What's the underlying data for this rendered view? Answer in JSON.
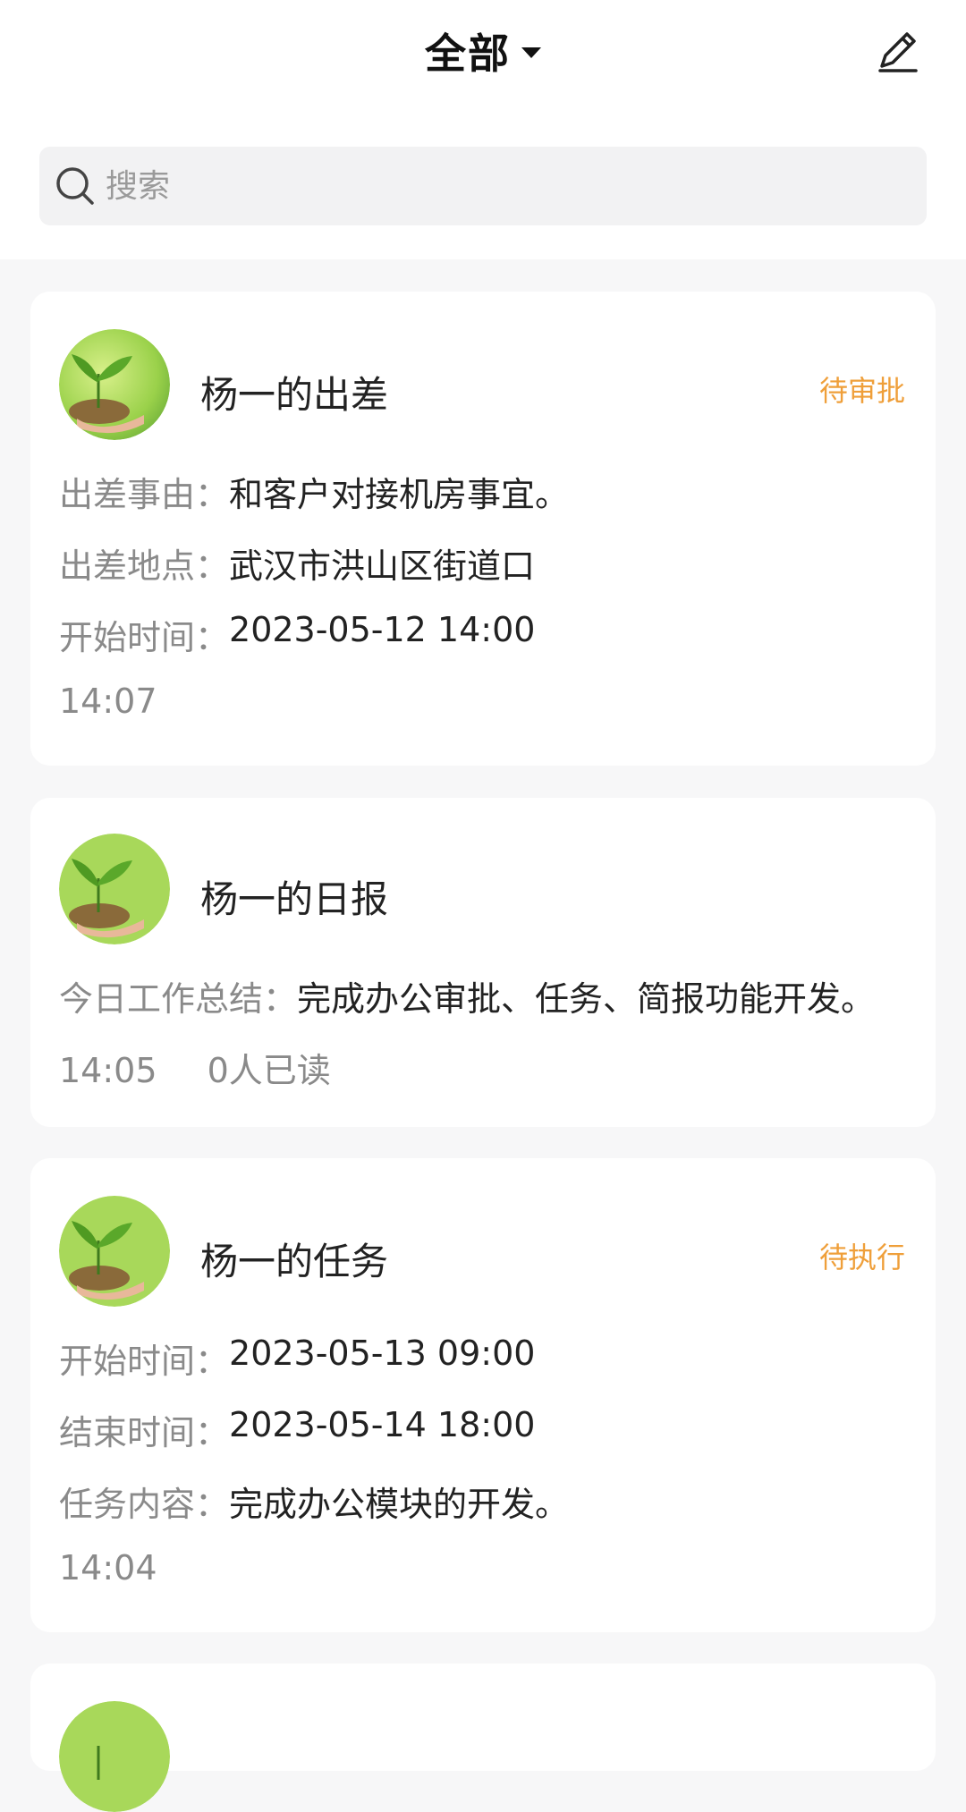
{
  "header": {
    "title": "全部",
    "dropdown_icon": "caret-down-icon",
    "edit_icon": "edit-pencil-icon"
  },
  "search": {
    "placeholder": "搜索",
    "icon": "search-icon"
  },
  "colors": {
    "status": "#ef9f3a",
    "label": "#8a8a8a",
    "text": "#222222",
    "background": "#f7f7f8"
  },
  "cards": [
    {
      "title": "杨一的出差",
      "status": "待审批",
      "fields": [
        {
          "label": "出差事由：",
          "value": "和客户对接机房事宜。"
        },
        {
          "label": "出差地点：",
          "value": "武汉市洪山区街道口"
        },
        {
          "label": "开始时间：",
          "value": "2023-05-12 14:00"
        }
      ],
      "time": "14:07"
    },
    {
      "title": "杨一的日报",
      "fields": [
        {
          "label": "今日工作总结：",
          "value": "完成办公审批、任务、简报功能开发。"
        }
      ],
      "time": "14:05",
      "read": "0人已读"
    },
    {
      "title": "杨一的任务",
      "status": "待执行",
      "fields": [
        {
          "label": "开始时间：",
          "value": "2023-05-13 09:00"
        },
        {
          "label": "结束时间：",
          "value": "2023-05-14 18:00"
        },
        {
          "label": "任务内容：",
          "value": "完成办公模块的开发。"
        }
      ],
      "time": "14:04"
    }
  ]
}
